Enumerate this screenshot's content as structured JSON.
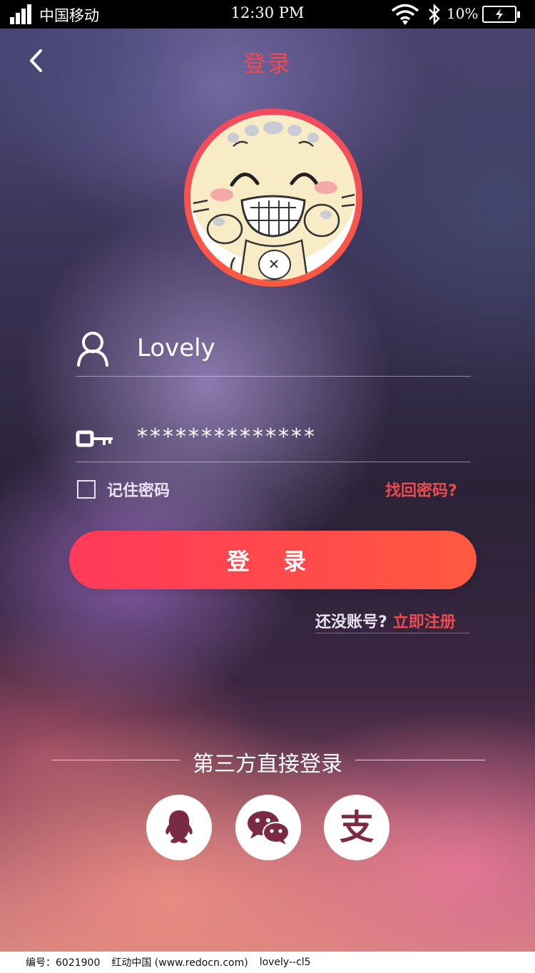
{
  "status_bar": {
    "carrier": "中国移动",
    "time": "12:30 PM",
    "battery_percent": "10%"
  },
  "nav": {
    "back_icon": "chevron-left-icon",
    "title": "登录"
  },
  "login_form": {
    "username_value": "Lovely",
    "username_icon": "user-icon",
    "password_value": "**************",
    "password_icon": "key-icon",
    "remember_label": "记住密码",
    "remember_checked": false,
    "forgot_link": "找回密码?",
    "login_button": "登 录",
    "no_account_text": "还没账号?",
    "register_link": "立即注册"
  },
  "third_party": {
    "title": "第三方直接登录",
    "providers": [
      {
        "name": "qq-icon"
      },
      {
        "name": "wechat-icon"
      },
      {
        "name": "alipay-icon",
        "glyph": "支"
      }
    ]
  },
  "footer": {
    "id_text": "编号：6021900",
    "site_text": "红动中国 (www.redocn.com)",
    "author_text": "lovely--cl5"
  },
  "colors": {
    "accent": "#ee4b4f",
    "button_gradient_start": "#ff3a5a",
    "button_gradient_end": "#ff5a40",
    "icon_color": "#7a2a45"
  }
}
